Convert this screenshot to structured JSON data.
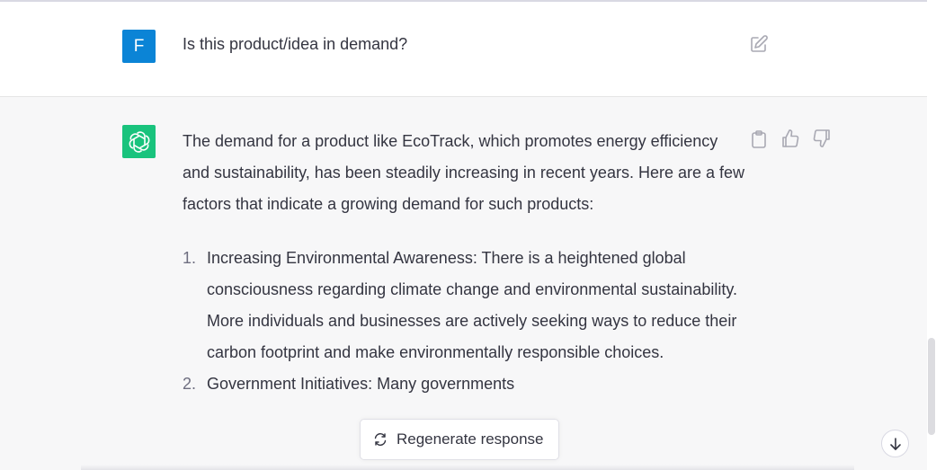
{
  "user_message": {
    "avatar_letter": "F",
    "text": "Is this product/idea in demand?",
    "edit_icon": "edit-icon"
  },
  "assistant_message": {
    "intro": "The demand for a product like EcoTrack, which promotes energy efficiency and sustainability, has been steadily increasing in recent years. Here are a few factors that indicate a growing demand for such products:",
    "items": [
      {
        "number": "1.",
        "text": "Increasing Environmental Awareness: There is a heightened global consciousness regarding climate change and environmental sustainability. More individuals and businesses are actively seeking ways to reduce their carbon footprint and make environmentally responsible choices."
      },
      {
        "number": "2.",
        "text": "Government Initiatives: Many governments"
      }
    ],
    "action_icons": [
      "clipboard-icon",
      "thumbs-up-icon",
      "thumbs-down-icon"
    ]
  },
  "regenerate_button": {
    "label": "Regenerate response",
    "icon": "refresh-icon"
  },
  "scroll_down_icon": "arrow-down-icon",
  "colors": {
    "user_avatar": "#0b84d6",
    "assistant_avatar": "#19c37d",
    "assistant_bg": "#f7f7f8",
    "text": "#343541"
  }
}
